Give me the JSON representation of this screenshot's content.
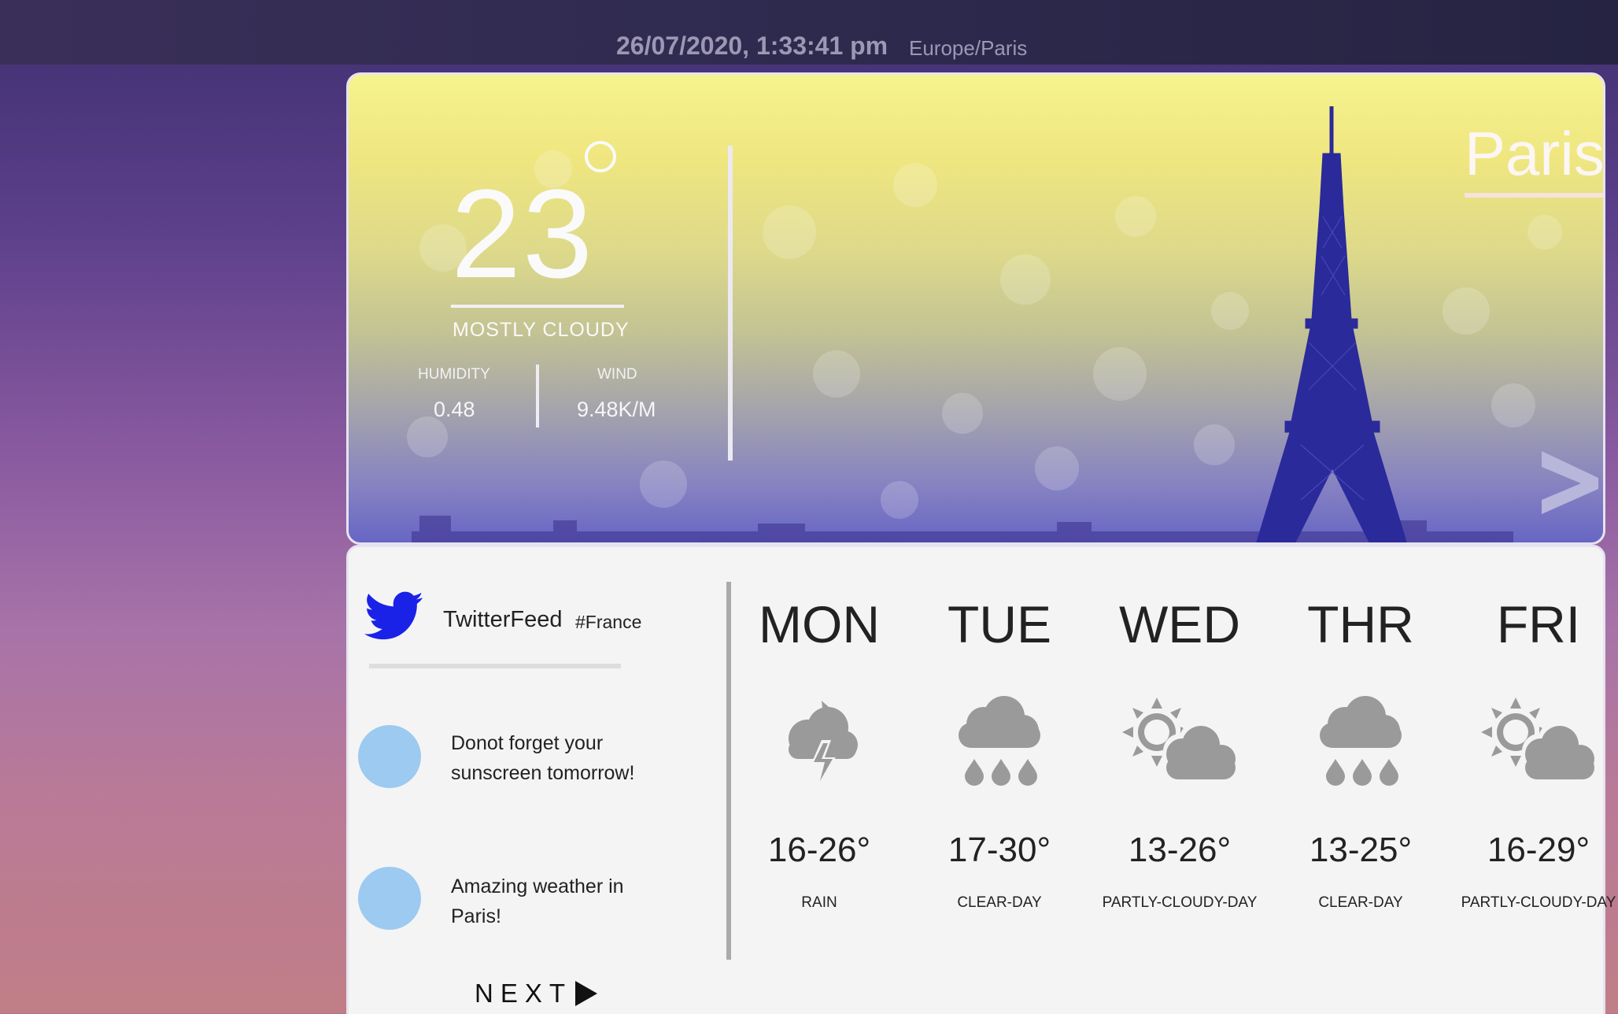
{
  "header": {
    "datetime": "26/07/2020, 1:33:41 pm",
    "timezone": "Europe/Paris"
  },
  "current": {
    "temperature": "23",
    "condition": "MOSTLY CLOUDY",
    "humidity_label": "HUMIDITY",
    "humidity_value": "0.48",
    "wind_label": "WIND",
    "wind_value": "9.48K/M",
    "city": "Paris",
    "next_arrow": ">"
  },
  "twitter": {
    "title": "TwitterFeed",
    "hashtag": "#France",
    "tweets": [
      {
        "text": "Donot forget your sunscreen tomorrow!"
      },
      {
        "text": "Amazing weather in Paris!"
      }
    ],
    "next_label": "NEXT"
  },
  "forecast": [
    {
      "day": "MON",
      "icon": "thunderstorm-icon",
      "temp": "16-26°",
      "summary": "RAIN"
    },
    {
      "day": "TUE",
      "icon": "rain-cloud-icon",
      "temp": "17-30°",
      "summary": "CLEAR-DAY"
    },
    {
      "day": "WED",
      "icon": "partly-cloudy-icon",
      "temp": "13-26°",
      "summary": "PARTLY-CLOUDY-DAY"
    },
    {
      "day": "THR",
      "icon": "rain-cloud-icon",
      "temp": "13-25°",
      "summary": "CLEAR-DAY"
    },
    {
      "day": "FRI",
      "icon": "partly-cloudy-icon",
      "temp": "16-29°",
      "summary": "PARTLY-CLOUDY-DAY"
    }
  ],
  "colors": {
    "accent_twitter": "#1a22e8",
    "avatar": "#9ccaf0",
    "icon_gray": "#9a9a9a"
  }
}
